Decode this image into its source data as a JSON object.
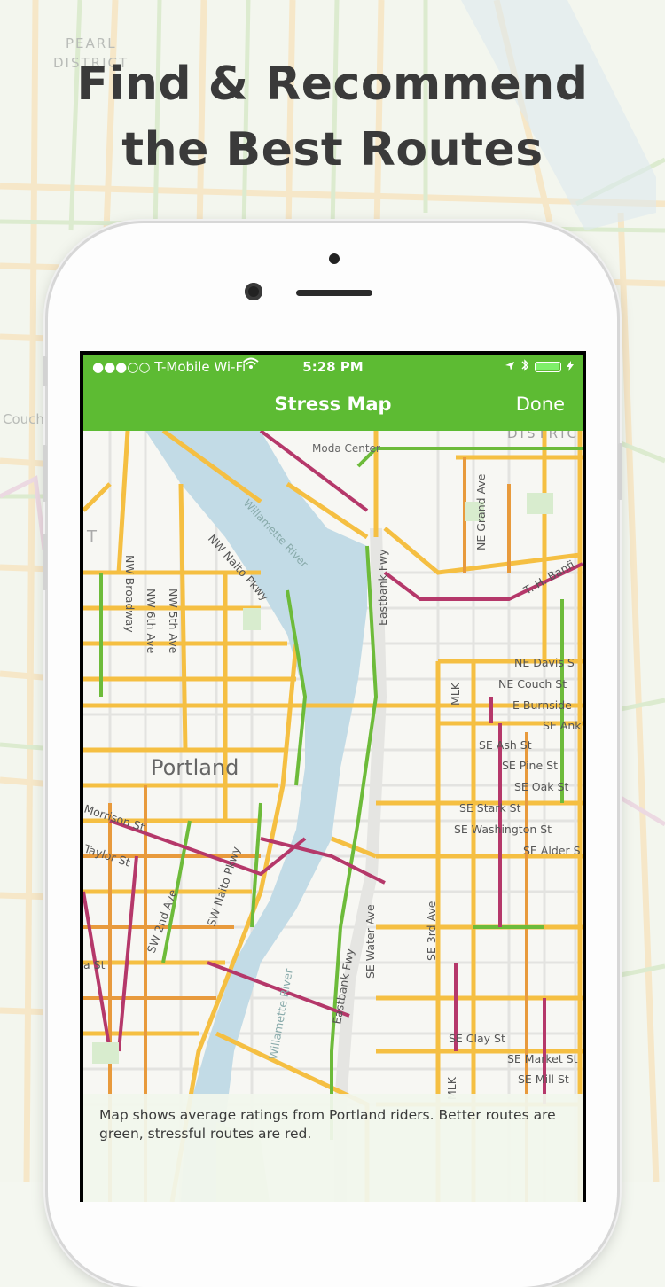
{
  "headline": {
    "line1": "Find & Recommend",
    "line2": "the Best Routes"
  },
  "background_labels": {
    "pearl": "PEARL",
    "district": "DISTRICT",
    "couch": "Couch"
  },
  "status_bar": {
    "carrier": "●●●○○ T-Mobile Wi-Fi",
    "time": "5:28 PM"
  },
  "nav": {
    "title": "Stress Map",
    "done_label": "Done"
  },
  "map_labels": {
    "district": "DISTRIC",
    "moda_center": "Moda Center",
    "willamette_river_north": "Willamette River",
    "nw_naito": "NW Naito Pkwy",
    "nw_broadway": "NW Broadway",
    "nw_5th": "NW 5th Ave",
    "nw_6th": "NW 6th Ave",
    "eastbank_north": "Eastbank Fwy",
    "ne_grand": "NE Grand Ave",
    "th_banfield": "T. H. Banfi",
    "ne_davis": "NE Davis S",
    "ne_couch": "NE Couch St",
    "e_burnside": "E Burnside",
    "se_ank": "SE Ank",
    "mlk_north": "MLK",
    "portland": "Portland",
    "se_ash": "SE Ash St",
    "se_pine": "SE Pine St",
    "se_oak": "SE Oak St",
    "se_stark": "SE Stark St",
    "se_washington": "SE Washington St",
    "se_alder": "SE Alder S",
    "morrison": "Morrison St",
    "taylor": "Taylor St",
    "sw_2nd": "SW 2nd Ave",
    "sw_naito": "SW Naito Pkwy",
    "se_water": "SE Water Ave",
    "se_3rd": "SE 3rd Ave",
    "eastbank_south": "Eastbank Fwy",
    "willamette_river_south": "Willamette River",
    "a_st": "a St",
    "se_clay": "SE Clay St",
    "se_market": "SE Market St",
    "se_mill": "SE Mill St",
    "mlk_south": "MLK",
    "t_left": "T"
  },
  "caption": "Map shows average ratings from Portland riders. Better routes are green, stressful routes are red.",
  "colors": {
    "accent": "#5dbb33",
    "green_route": "#6dbb3a",
    "red_route": "#b5386a",
    "yellow_route": "#f5bf42",
    "orange_route": "#e89a3c",
    "river": "#c2dbe6"
  }
}
